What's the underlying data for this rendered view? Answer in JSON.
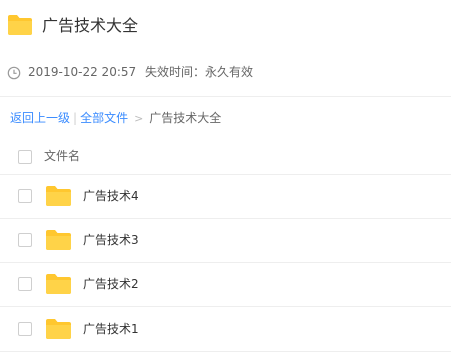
{
  "header": {
    "icon": "folder-icon",
    "title": "广告技术大全"
  },
  "meta": {
    "icon": "clock-icon",
    "date": "2019-10-22 20:57",
    "expiry": "失效时间：永久有效"
  },
  "breadcrumb": {
    "back_label": "返回上一级",
    "separator": "|",
    "all_files_label": "全部文件",
    "arrow": ">",
    "current": "广告技术大全"
  },
  "list": {
    "header_label": "文件名",
    "items": [
      {
        "name": "广告技术4",
        "icon": "folder-icon"
      },
      {
        "name": "广告技术3",
        "icon": "folder-icon"
      },
      {
        "name": "广告技术2",
        "icon": "folder-icon"
      },
      {
        "name": "广告技术1",
        "icon": "folder-icon"
      }
    ]
  },
  "colors": {
    "folder": "#FFC72F",
    "link": "#3B8CFF",
    "divider": "#EEEEEE"
  }
}
